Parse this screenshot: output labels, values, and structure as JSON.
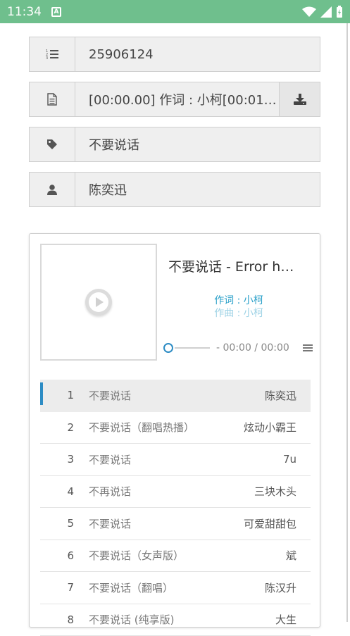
{
  "status": {
    "time": "11:34",
    "badge": "A"
  },
  "fields": {
    "id": "25906124",
    "lyric": "[00:00.00] 作词 : 小柯[00:01…",
    "title": "不要说话",
    "artist": "陈奕迅"
  },
  "player": {
    "title": "不要说话 - Error h…",
    "lyrics": [
      "作词 : 小柯",
      "作曲 : 小柯"
    ],
    "time": "- 00:00 / 00:00",
    "progress": 0
  },
  "playlist": [
    {
      "num": "1",
      "title": "不要说话",
      "artist": "陈奕迅",
      "active": true
    },
    {
      "num": "2",
      "title": "不要说话（翻唱热播）",
      "artist": "炫动小霸王",
      "active": false
    },
    {
      "num": "3",
      "title": "不要说话",
      "artist": "7u",
      "active": false
    },
    {
      "num": "4",
      "title": "不再说话",
      "artist": "三块木头",
      "active": false
    },
    {
      "num": "5",
      "title": "不要说话",
      "artist": "可爱甜甜包",
      "active": false
    },
    {
      "num": "6",
      "title": "不要说话（女声版）",
      "artist": "斌",
      "active": false
    },
    {
      "num": "7",
      "title": "不要说话（翻唱）",
      "artist": "陈汉升",
      "active": false
    },
    {
      "num": "8",
      "title": "不要说话 (纯享版)",
      "artist": "大生",
      "active": false
    }
  ],
  "colors": {
    "status_bar": "#6fbf8d",
    "accent": "#2d8cc4",
    "lyric": "#2aa0c9"
  },
  "icons": {
    "id": "ordered-list-icon",
    "lyric": "document-icon",
    "download": "download-icon",
    "title": "tag-icon",
    "artist": "user-icon",
    "play": "play-icon",
    "menu": "menu-icon"
  }
}
